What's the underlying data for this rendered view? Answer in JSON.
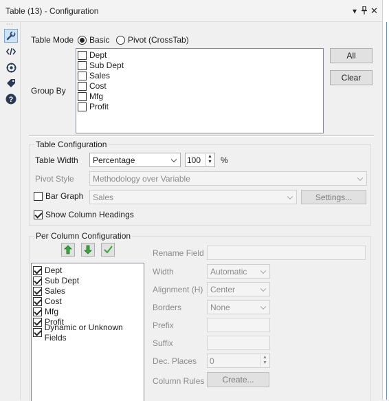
{
  "window": {
    "title": "Table (13) - Configuration",
    "ctrl_dropdown": "▾",
    "ctrl_pin": "🖈",
    "ctrl_close": "✕"
  },
  "sidebar": {
    "dots": "⋯",
    "icons": [
      "wrench-icon",
      "code-icon",
      "target-icon",
      "tag-icon",
      "help-icon"
    ]
  },
  "table_mode": {
    "label": "Table Mode",
    "options": [
      "Basic",
      "Pivot (CrossTab)"
    ],
    "selected": "Basic"
  },
  "group_by": {
    "label": "Group By",
    "items": [
      "Dept",
      "Sub Dept",
      "Sales",
      "Cost",
      "Mfg",
      "Profit"
    ],
    "all_label": "All",
    "clear_label": "Clear"
  },
  "table_config": {
    "title": "Table Configuration",
    "width_label": "Table Width",
    "width_mode": "Percentage",
    "width_value": "100",
    "width_unit": "%",
    "pivot_style_label": "Pivot Style",
    "pivot_style_value": "Methodology over Variable",
    "bar_graph_label": "Bar Graph",
    "bar_graph_value": "Sales",
    "settings_label": "Settings...",
    "show_headings_label": "Show Column Headings"
  },
  "per_column": {
    "title": "Per Column Configuration",
    "fields": [
      "Dept",
      "Sub Dept",
      "Sales",
      "Cost",
      "Mfg",
      "Profit",
      "Dynamic or Unknown Fields"
    ],
    "rename_label": "Rename Field",
    "width_label": "Width",
    "width_value": "Automatic",
    "alignment_label": "Alignment (H)",
    "alignment_value": "Center",
    "borders_label": "Borders",
    "borders_value": "None",
    "prefix_label": "Prefix",
    "suffix_label": "Suffix",
    "dec_places_label": "Dec. Places",
    "dec_places_value": "0",
    "column_rules_label": "Column Rules",
    "create_label": "Create..."
  },
  "colors": {
    "green_arrow": "#3aa53a",
    "active_tool_bg": "#cfe3f7"
  }
}
